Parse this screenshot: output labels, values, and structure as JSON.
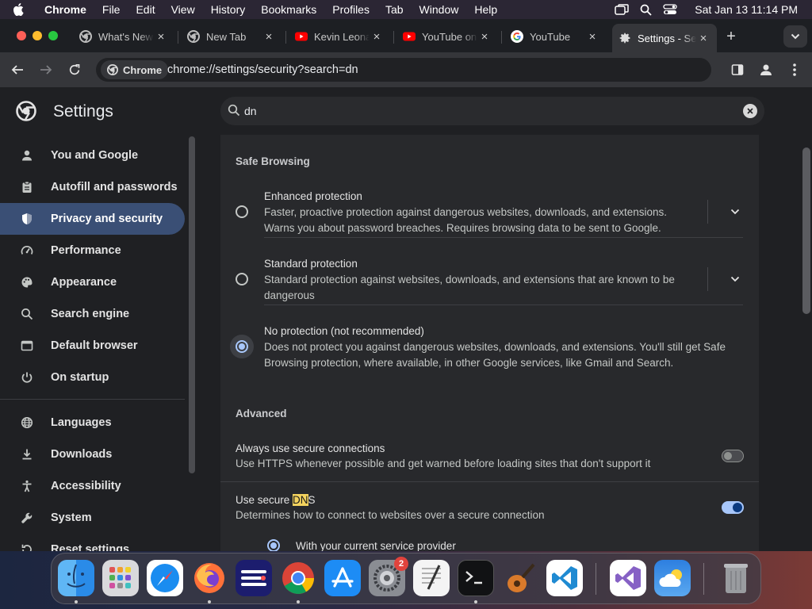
{
  "menubar": {
    "app_name": "Chrome",
    "items": [
      "File",
      "Edit",
      "View",
      "History",
      "Bookmarks",
      "Profiles",
      "Tab",
      "Window",
      "Help"
    ],
    "clock": "Sat Jan 13  11:14 PM"
  },
  "tabs": [
    {
      "title": "What's New",
      "icon": "chrome-icon",
      "close": "×"
    },
    {
      "title": "New Tab",
      "icon": "chrome-icon",
      "close": "×"
    },
    {
      "title": "Kevin Leonard",
      "icon": "youtube-icon",
      "close": "×"
    },
    {
      "title": "YouTube on",
      "icon": "youtube-icon",
      "close": "×"
    },
    {
      "title": "YouTube",
      "icon": "google-icon",
      "close": "×"
    },
    {
      "title": "Settings - Security",
      "icon": "gear-icon",
      "close": "×",
      "active": true
    }
  ],
  "new_tab_label": "+",
  "omnibox": {
    "chip_label": "Chrome",
    "url": "chrome://settings/security?search=dn"
  },
  "settings": {
    "title": "Settings",
    "search_value": "dn"
  },
  "sidebar": {
    "items": [
      {
        "label": "You and Google",
        "icon": "person-icon"
      },
      {
        "label": "Autofill and passwords",
        "icon": "clipboard-icon"
      },
      {
        "label": "Privacy and security",
        "icon": "shield-icon",
        "active": true
      },
      {
        "label": "Performance",
        "icon": "speedometer-icon"
      },
      {
        "label": "Appearance",
        "icon": "palette-icon"
      },
      {
        "label": "Search engine",
        "icon": "search-icon"
      },
      {
        "label": "Default browser",
        "icon": "browser-icon"
      },
      {
        "label": "On startup",
        "icon": "power-icon"
      },
      {
        "label": "Languages",
        "icon": "globe-icon"
      },
      {
        "label": "Downloads",
        "icon": "download-icon"
      },
      {
        "label": "Accessibility",
        "icon": "accessibility-icon"
      },
      {
        "label": "System",
        "icon": "wrench-icon"
      },
      {
        "label": "Reset settings",
        "icon": "reset-icon"
      }
    ]
  },
  "safe_browsing": {
    "heading": "Safe Browsing",
    "options": [
      {
        "title": "Enhanced protection",
        "desc": "Faster, proactive protection against dangerous websites, downloads, and extensions.\nWarns you about password breaches. Requires browsing data to be sent to Google.",
        "selected": false
      },
      {
        "title": "Standard protection",
        "desc": "Standard protection against websites, downloads, and extensions that are known to be\ndangerous",
        "selected": false
      },
      {
        "title": "No protection (not recommended)",
        "desc": "Does not protect you against dangerous websites, downloads, and extensions. You'll still get Safe\nBrowsing protection, where available, in other Google services, like Gmail and Search.",
        "selected": true
      }
    ]
  },
  "advanced": {
    "heading": "Advanced",
    "https": {
      "title": "Always use secure connections",
      "desc": "Use HTTPS whenever possible and get warned before loading sites that don't support it",
      "enabled": false
    },
    "dns": {
      "title_before": "Use secure ",
      "title_highlight": "DN",
      "title_after": "S",
      "desc": "Determines how to connect to websites over a secure connection",
      "enabled": true,
      "provider_option": "With your current service provider"
    }
  },
  "dock": {
    "apps": [
      "Finder",
      "Launchpad",
      "Safari",
      "Firefox",
      "Fenix",
      "Google Chrome",
      "App Store",
      "System Settings",
      "TextEdit",
      "Terminal",
      "GarageBand",
      "Visual Studio Code",
      "Visual Studio",
      "Weather",
      "Trash"
    ],
    "settings_badge": "2"
  },
  "colors": {
    "accent": "#a8c7fa",
    "active_nav": "#3a4f75",
    "highlight": "#f4d35e"
  }
}
